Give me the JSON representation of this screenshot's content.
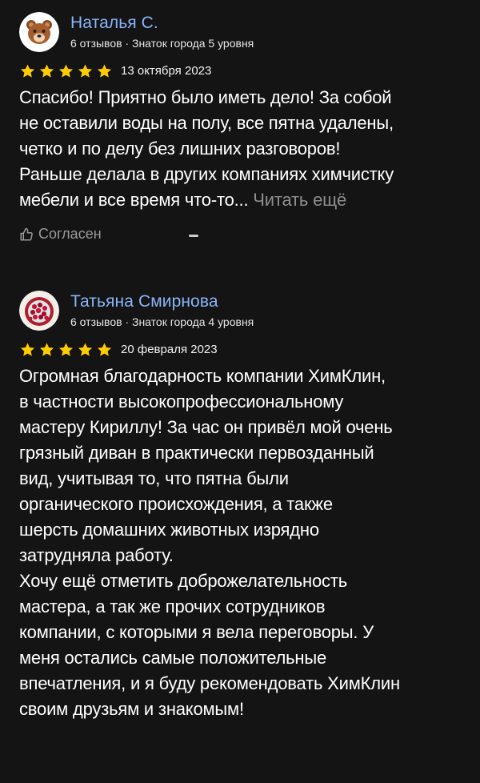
{
  "reviews": [
    {
      "author": "Наталья С.",
      "meta": "6 отзывов · Знаток города 5 уровня",
      "avatar_icon": "bear-icon",
      "rating": 5,
      "date": "13 октября 2023",
      "text": "Спасибо! Приятно было иметь дело! За собой\nне оставили воды на полу, все пятна удалены,\nчетко и по делу без лишних разговоров!\nРаньше делала в других компаниях химчистку\nмебели и все время что-то... ",
      "read_more": "Читать ещё",
      "agree_label": "Согласен"
    },
    {
      "author": "Татьяна Смирнова",
      "meta": "6 отзывов · Знаток города 4 уровня",
      "avatar_icon": "pomegranate-icon",
      "rating": 5,
      "date": "20 февраля 2023",
      "text": "Огромная благодарность компании ХимКлин,\nв частности высокопрофессиональному\nмастеру Кириллу! За час он привёл мой очень\nгрязный диван в практически первозданный\nвид, учитывая то, что пятна были\nорганического происхождения, а также\nшерсть домашних животных изрядно\nзатрудняла работу.\nХочу ещё отметить доброжелательность\nмастера, а так же прочих сотрудников\nкомпании, с которыми я вела переговоры. У\nменя остались самые положительные\nвпечатления, и я буду рекомендовать ХимКлин\nсвоим друзьям и знакомым!"
    }
  ],
  "colors": {
    "background": "#141414",
    "author_name": "#8ab4f8",
    "star": "#ffcc00",
    "muted": "#8e8e8e"
  }
}
